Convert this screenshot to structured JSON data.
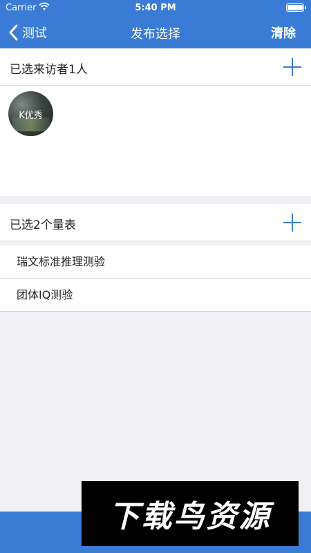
{
  "status_bar": {
    "carrier": "Carrier",
    "time": "5:40 PM"
  },
  "nav": {
    "back_label": "测试",
    "title": "发布选择",
    "clear_label": "清除"
  },
  "visitors": {
    "title": "已选来访者1人",
    "items": [
      {
        "name": "K优秀"
      }
    ]
  },
  "scales": {
    "title": "已选2个量表",
    "items": [
      {
        "name": "瑞文标准推理测验"
      },
      {
        "name": "团体IQ测验"
      }
    ]
  },
  "watermark": "下载鸟资源",
  "colors": {
    "accent": "#3a7bd5",
    "background": "#efeff4"
  }
}
